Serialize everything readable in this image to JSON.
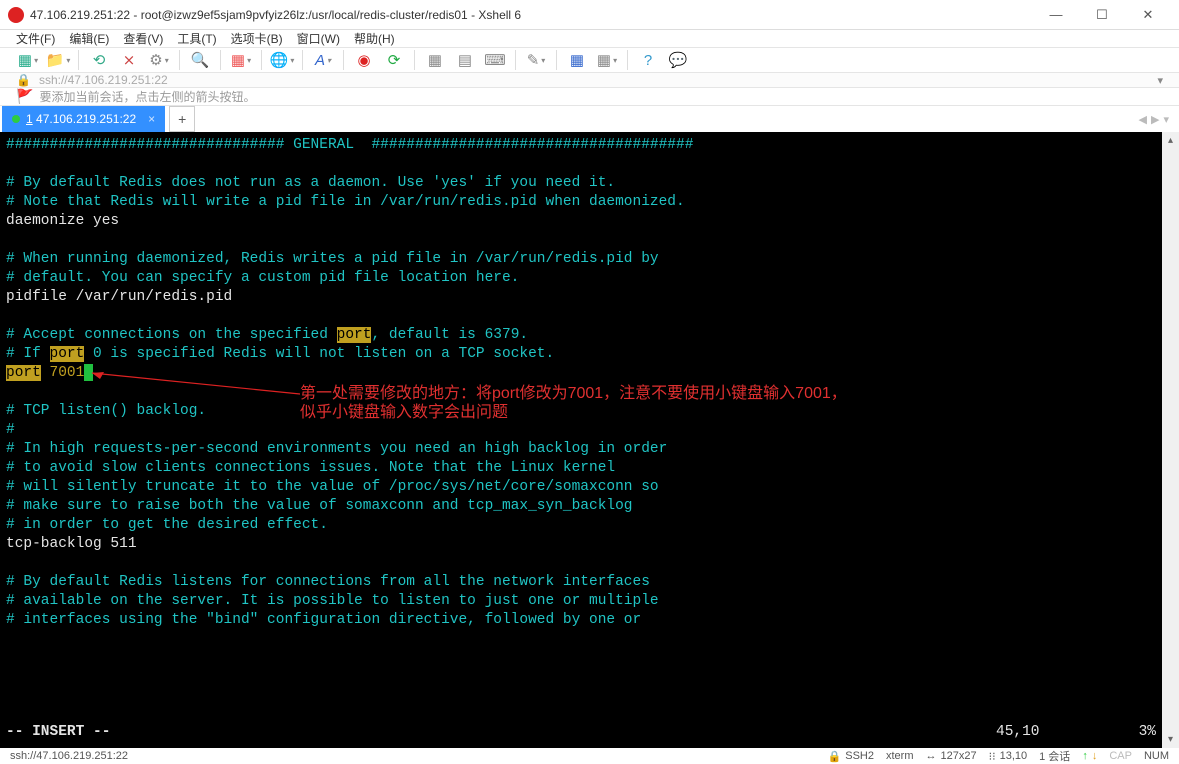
{
  "window": {
    "title": "47.106.219.251:22 - root@izwz9ef5sjam9pvfyiz26lz:/usr/local/redis-cluster/redis01 - Xshell 6"
  },
  "menu": {
    "items": [
      "文件(F)",
      "编辑(E)",
      "查看(V)",
      "工具(T)",
      "选项卡(B)",
      "窗口(W)",
      "帮助(H)"
    ]
  },
  "url": "ssh://47.106.219.251:22",
  "hint": "要添加当前会话，点击左侧的箭头按钮。",
  "tab": {
    "label": "1 47.106.219.251:22"
  },
  "term": {
    "lines": [
      {
        "segs": [
          {
            "t": "################################ GENERAL  #####################################",
            "c": "teal"
          }
        ]
      },
      {
        "segs": []
      },
      {
        "segs": [
          {
            "t": "# By default Redis does not run as a daemon. Use 'yes' if you need it.",
            "c": "teal"
          }
        ]
      },
      {
        "segs": [
          {
            "t": "# Note that Redis will write a pid file in /var/run/redis.pid when daemonized.",
            "c": "teal"
          }
        ]
      },
      {
        "segs": [
          {
            "t": "daemonize yes",
            "c": "white"
          }
        ]
      },
      {
        "segs": []
      },
      {
        "segs": [
          {
            "t": "# When running daemonized, Redis writes a pid file in /var/run/redis.pid by",
            "c": "teal"
          }
        ]
      },
      {
        "segs": [
          {
            "t": "# default. You can specify a custom pid file location here.",
            "c": "teal"
          }
        ]
      },
      {
        "segs": [
          {
            "t": "pidfile /var/run/redis.pid",
            "c": "white"
          }
        ]
      },
      {
        "segs": []
      },
      {
        "segs": [
          {
            "t": "# Accept connections on the specified ",
            "c": "teal"
          },
          {
            "t": "port",
            "c": "hl"
          },
          {
            "t": ", default is 6379.",
            "c": "teal"
          }
        ]
      },
      {
        "segs": [
          {
            "t": "# If ",
            "c": "teal"
          },
          {
            "t": "port",
            "c": "hl"
          },
          {
            "t": " 0 is specified Redis will not listen on a TCP socket.",
            "c": "teal"
          }
        ]
      },
      {
        "segs": [
          {
            "t": "port",
            "c": "hl"
          },
          {
            "t": " 7001",
            "c": "yellow"
          },
          {
            "t": "",
            "cursor": true
          }
        ]
      },
      {
        "segs": []
      },
      {
        "segs": [
          {
            "t": "# TCP listen() backlog.",
            "c": "teal"
          }
        ]
      },
      {
        "segs": [
          {
            "t": "#",
            "c": "teal"
          }
        ]
      },
      {
        "segs": [
          {
            "t": "# In high requests-per-second environments you need an high backlog in order",
            "c": "teal"
          }
        ]
      },
      {
        "segs": [
          {
            "t": "# to avoid slow clients connections issues. Note that the Linux kernel",
            "c": "teal"
          }
        ]
      },
      {
        "segs": [
          {
            "t": "# will silently truncate it to the value of /proc/sys/net/core/somaxconn so",
            "c": "teal"
          }
        ]
      },
      {
        "segs": [
          {
            "t": "# make sure to raise both the value of somaxconn and tcp_max_syn_backlog",
            "c": "teal"
          }
        ]
      },
      {
        "segs": [
          {
            "t": "# in order to get the desired effect.",
            "c": "teal"
          }
        ]
      },
      {
        "segs": [
          {
            "t": "tcp-backlog 511",
            "c": "white"
          }
        ]
      },
      {
        "segs": []
      },
      {
        "segs": [
          {
            "t": "# By default Redis listens for connections from all the network interfaces",
            "c": "teal"
          }
        ]
      },
      {
        "segs": [
          {
            "t": "# available on the server. It is possible to listen to just one or multiple",
            "c": "teal"
          }
        ]
      },
      {
        "segs": [
          {
            "t": "# interfaces using the \"bind\" configuration directive, followed by one or",
            "c": "teal"
          }
        ]
      }
    ],
    "status_left": "-- INSERT --",
    "status_mid": "45,10",
    "status_right": "3%",
    "annotation": {
      "line1": "第一处需要修改的地方：将port修改为7001，注意不要使用小键盘输入7001，",
      "line2": "似乎小键盘输入数字会出问题"
    }
  },
  "statusbar": {
    "left": "ssh://47.106.219.251:22",
    "ssh": "SSH2",
    "term_type": "xterm",
    "size": "127x27",
    "pos": "13,10",
    "sessions": "1 会话",
    "cap": "CAP",
    "num": "NUM"
  }
}
